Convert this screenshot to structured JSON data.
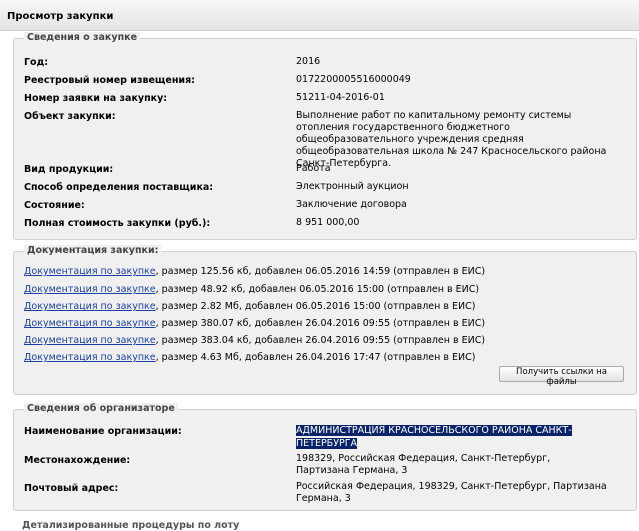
{
  "page_title": "Просмотр закупки",
  "purchase": {
    "legend": "Сведения о закупке",
    "rows": [
      {
        "label": "Год:",
        "value": "2016"
      },
      {
        "label": "Реестровый номер извещения:",
        "value": "0172200005516000049"
      },
      {
        "label": "Номер заявки на закупку:",
        "value": "51211-04-2016-01"
      },
      {
        "label": "Объект закупки:",
        "value": "Выполнение работ по капитальному ремонту системы отопления государственного бюджетного общеобразовательного учреждения средняя общеобразовательная школа № 247 Красносельского района Санкт-Петербурга."
      },
      {
        "label": "Вид продукции:",
        "value": "Работа"
      },
      {
        "label": "Способ определения поставщика:",
        "value": "Электронный аукцион"
      },
      {
        "label": "Состояние:",
        "value": "Заключение договора"
      },
      {
        "label": "Полная стоимость закупки (руб.):",
        "value": "8 951 000,00"
      }
    ]
  },
  "documentation": {
    "legend": "Документация закупки:",
    "items": [
      {
        "link": "Документация по закупке",
        "info": ", размер 125.56 кб, добавлен 06.05.2016 14:59 (отправлен в ЕИС)"
      },
      {
        "link": "Документация по закупке",
        "info": ", размер 48.92 кб, добавлен 06.05.2016 15:00 (отправлен в ЕИС)"
      },
      {
        "link": "Документация по закупке",
        "info": ", размер 2.82 Мб, добавлен 06.05.2016 15:00 (отправлен в ЕИС)"
      },
      {
        "link": "Документация по закупке",
        "info": ", размер 380.07 кб, добавлен 26.04.2016 09:55 (отправлен в ЕИС)"
      },
      {
        "link": "Документация по закупке",
        "info": ", размер 383.04 кб, добавлен 26.04.2016 09:55 (отправлен в ЕИС)"
      },
      {
        "link": "Документация по закупке",
        "info": ", размер 4.63 Мб, добавлен 26.04.2016 17:47 (отправлен в ЕИС)"
      }
    ],
    "button_label": "Получить ссылки на файлы"
  },
  "organizer": {
    "legend": "Сведения об организаторе",
    "rows": [
      {
        "label": "Наименование организации:",
        "value": "АДМИНИСТРАЦИЯ КРАСНОСЕЛЬСКОГО РАЙОНА САНКТ-ПЕТЕРБУРГА"
      },
      {
        "label": "Местонахождение:",
        "value": "198329, Российская Федерация, Санкт-Петербург, Партизана Германа, 3"
      },
      {
        "label": "Почтовый адрес:",
        "value": "Российская Федерация, 198329, Санкт-Петербург, Партизана Германа, 3"
      }
    ]
  },
  "next_section_legend": "Детализированные процедуры по лоту"
}
